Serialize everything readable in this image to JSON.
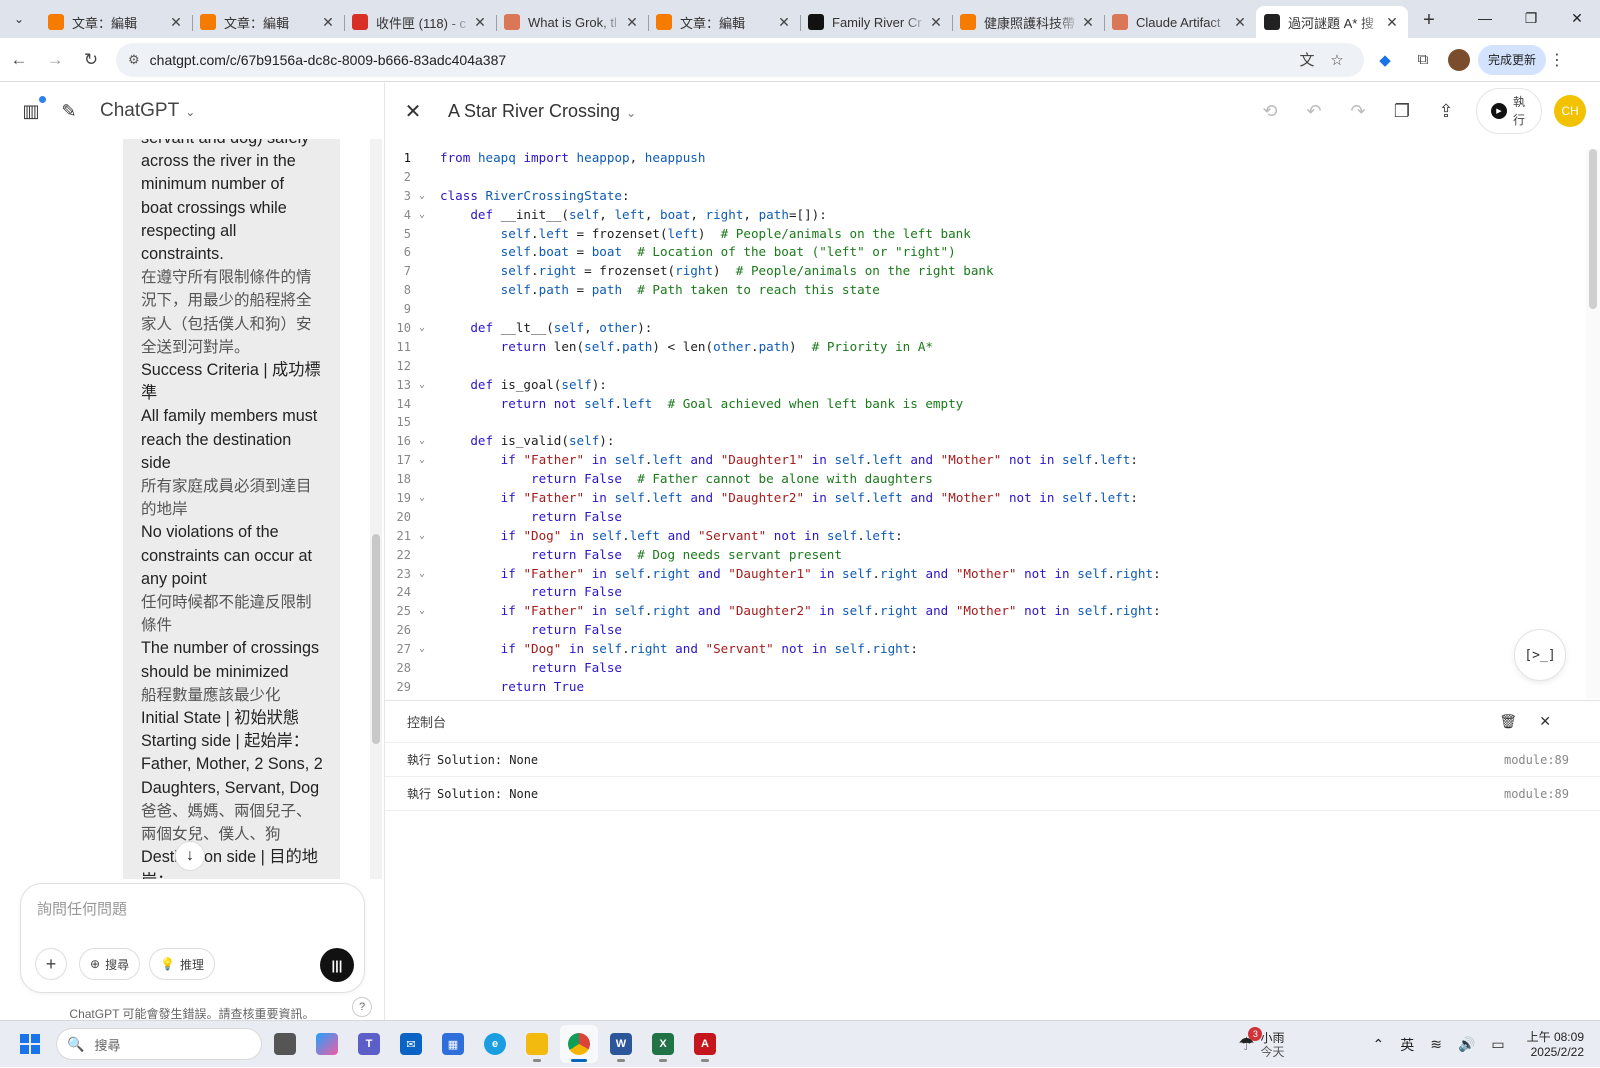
{
  "browser": {
    "tabs": [
      {
        "title": "文章：編輯",
        "favicon": "blogger-icon",
        "color": "#f57c00",
        "active": false
      },
      {
        "title": "文章：編輯",
        "favicon": "blogger-icon",
        "color": "#f57c00",
        "active": false
      },
      {
        "title": "收件匣 (118) - c",
        "favicon": "gmail-icon",
        "color": "#d93025",
        "active": false
      },
      {
        "title": "What is Grok, tl",
        "favicon": "claude-icon",
        "color": "#d97757",
        "active": false
      },
      {
        "title": "文章：編輯",
        "favicon": "blogger-icon",
        "color": "#f57c00",
        "active": false
      },
      {
        "title": "Family River Cr",
        "favicon": "x-icon",
        "color": "#111111",
        "active": false
      },
      {
        "title": "健康照護科技帶",
        "favicon": "blogger-icon",
        "color": "#f57c00",
        "active": false
      },
      {
        "title": "Claude Artifact",
        "favicon": "claude-icon",
        "color": "#d97757",
        "active": false
      },
      {
        "title": "過河謎題 A* 搜",
        "favicon": "chatgpt-icon",
        "color": "#222222",
        "active": true
      }
    ],
    "url": "chatgpt.com/c/67b9156a-dc8c-8009-b666-83adc404a387",
    "update_label": "完成更新"
  },
  "chat": {
    "brand": "ChatGPT",
    "message_lines": [
      {
        "text": "servant and dog) safely",
        "zh": false
      },
      {
        "text": "across the river in the",
        "zh": false
      },
      {
        "text": "minimum number of",
        "zh": false
      },
      {
        "text": "boat crossings while",
        "zh": false
      },
      {
        "text": "respecting all",
        "zh": false
      },
      {
        "text": "constraints.",
        "zh": false
      },
      {
        "text": "在遵守所有限制條件的情",
        "zh": true
      },
      {
        "text": "況下，用最少的船程將全",
        "zh": true
      },
      {
        "text": "家人（包括僕人和狗）安",
        "zh": true
      },
      {
        "text": "全送到河對岸。",
        "zh": true
      },
      {
        "text": "Success Criteria | 成功標",
        "zh": false
      },
      {
        "text": "準",
        "zh": false
      },
      {
        "text": "All family members must",
        "zh": false
      },
      {
        "text": "reach the destination",
        "zh": false
      },
      {
        "text": "side",
        "zh": false
      },
      {
        "text": "所有家庭成員必須到達目",
        "zh": true
      },
      {
        "text": "的地岸",
        "zh": true
      },
      {
        "text": "No violations of the",
        "zh": false
      },
      {
        "text": "constraints can occur at",
        "zh": false
      },
      {
        "text": "any point",
        "zh": false
      },
      {
        "text": "任何時候都不能違反限制",
        "zh": true
      },
      {
        "text": "條件",
        "zh": true
      },
      {
        "text": "The number of crossings",
        "zh": false
      },
      {
        "text": "should be minimized",
        "zh": false
      },
      {
        "text": "船程數量應該最少化",
        "zh": true
      },
      {
        "text": "Initial State | 初始狀態",
        "zh": false
      },
      {
        "text": "Starting side | 起始岸：",
        "zh": false
      },
      {
        "text": "Father, Mother, 2 Sons, 2",
        "zh": false
      },
      {
        "text": "Daughters, Servant, Dog",
        "zh": false
      },
      {
        "text": "爸爸、媽媽、兩個兒子、",
        "zh": true
      },
      {
        "text": "兩個女兒、僕人、狗",
        "zh": true
      },
      {
        "text": "Destination side | 目的地",
        "zh": false
      },
      {
        "text": "岸：",
        "zh": false
      }
    ],
    "composer_placeholder": "詢問任何問題",
    "search_label": "搜尋",
    "reason_label": "推理",
    "disclaimer": "ChatGPT 可能會發生錯誤。請查核重要資訊。",
    "help": "?"
  },
  "canvas": {
    "title": "A Star River Crossing",
    "run_label": "執行",
    "user_initials": "CH",
    "code_lines": [
      "<span class=\"kw\">from</span> <span class=\"bl\">heapq</span> <span class=\"kw\">import</span> <span class=\"bl\">heappop</span>, <span class=\"bl\">heappush</span>",
      "",
      "<span class=\"kw\">class</span> <span class=\"cls\">RiverCrossingState</span>:",
      "    <span class=\"kw\">def</span> <span class=\"fn\">__init__</span>(<span class=\"bl\">self</span>, <span class=\"bl\">left</span>, <span class=\"bl\">boat</span>, <span class=\"bl\">right</span>, <span class=\"bl\">path</span>=[]):",
      "        <span class=\"bl\">self</span>.<span class=\"bl\">left</span> = <span class=\"fn\">frozenset</span>(<span class=\"bl\">left</span>)  <span class=\"cm\"># People/animals on the left bank</span>",
      "        <span class=\"bl\">self</span>.<span class=\"bl\">boat</span> = <span class=\"bl\">boat</span>  <span class=\"cm\"># Location of the boat (\"left\" or \"right\")</span>",
      "        <span class=\"bl\">self</span>.<span class=\"bl\">right</span> = <span class=\"fn\">frozenset</span>(<span class=\"bl\">right</span>)  <span class=\"cm\"># People/animals on the right bank</span>",
      "        <span class=\"bl\">self</span>.<span class=\"bl\">path</span> = <span class=\"bl\">path</span>  <span class=\"cm\"># Path taken to reach this state</span>",
      "",
      "    <span class=\"kw\">def</span> <span class=\"fn\">__lt__</span>(<span class=\"bl\">self</span>, <span class=\"bl\">other</span>):",
      "        <span class=\"kw\">return</span> <span class=\"fn\">len</span>(<span class=\"bl\">self</span>.<span class=\"bl\">path</span>) &lt; <span class=\"fn\">len</span>(<span class=\"bl\">other</span>.<span class=\"bl\">path</span>)  <span class=\"cm\"># Priority in A*</span>",
      "",
      "    <span class=\"kw\">def</span> <span class=\"fn\">is_goal</span>(<span class=\"bl\">self</span>):",
      "        <span class=\"kw\">return</span> <span class=\"kw\">not</span> <span class=\"bl\">self</span>.<span class=\"bl\">left</span>  <span class=\"cm\"># Goal achieved when left bank is empty</span>",
      "",
      "    <span class=\"kw\">def</span> <span class=\"fn\">is_valid</span>(<span class=\"bl\">self</span>):",
      "        <span class=\"kw\">if</span> <span class=\"st\">\"Father\"</span> <span class=\"kw\">in</span> <span class=\"bl\">self</span>.<span class=\"bl\">left</span> <span class=\"kw\">and</span> <span class=\"st\">\"Daughter1\"</span> <span class=\"kw\">in</span> <span class=\"bl\">self</span>.<span class=\"bl\">left</span> <span class=\"kw\">and</span> <span class=\"st\">\"Mother\"</span> <span class=\"kw\">not</span> <span class=\"kw\">in</span> <span class=\"bl\">self</span>.<span class=\"bl\">left</span>:",
      "            <span class=\"kw\">return</span> <span class=\"kw\">False</span>  <span class=\"cm\"># Father cannot be alone with daughters</span>",
      "        <span class=\"kw\">if</span> <span class=\"st\">\"Father\"</span> <span class=\"kw\">in</span> <span class=\"bl\">self</span>.<span class=\"bl\">left</span> <span class=\"kw\">and</span> <span class=\"st\">\"Daughter2\"</span> <span class=\"kw\">in</span> <span class=\"bl\">self</span>.<span class=\"bl\">left</span> <span class=\"kw\">and</span> <span class=\"st\">\"Mother\"</span> <span class=\"kw\">not</span> <span class=\"kw\">in</span> <span class=\"bl\">self</span>.<span class=\"bl\">left</span>:",
      "            <span class=\"kw\">return</span> <span class=\"kw\">False</span>",
      "        <span class=\"kw\">if</span> <span class=\"st\">\"Dog\"</span> <span class=\"kw\">in</span> <span class=\"bl\">self</span>.<span class=\"bl\">left</span> <span class=\"kw\">and</span> <span class=\"st\">\"Servant\"</span> <span class=\"kw\">not</span> <span class=\"kw\">in</span> <span class=\"bl\">self</span>.<span class=\"bl\">left</span>:",
      "            <span class=\"kw\">return</span> <span class=\"kw\">False</span>  <span class=\"cm\"># Dog needs servant present</span>",
      "        <span class=\"kw\">if</span> <span class=\"st\">\"Father\"</span> <span class=\"kw\">in</span> <span class=\"bl\">self</span>.<span class=\"bl\">right</span> <span class=\"kw\">and</span> <span class=\"st\">\"Daughter1\"</span> <span class=\"kw\">in</span> <span class=\"bl\">self</span>.<span class=\"bl\">right</span> <span class=\"kw\">and</span> <span class=\"st\">\"Mother\"</span> <span class=\"kw\">not</span> <span class=\"kw\">in</span> <span class=\"bl\">self</span>.<span class=\"bl\">right</span>:",
      "            <span class=\"kw\">return</span> <span class=\"kw\">False</span>",
      "        <span class=\"kw\">if</span> <span class=\"st\">\"Father\"</span> <span class=\"kw\">in</span> <span class=\"bl\">self</span>.<span class=\"bl\">right</span> <span class=\"kw\">and</span> <span class=\"st\">\"Daughter2\"</span> <span class=\"kw\">in</span> <span class=\"bl\">self</span>.<span class=\"bl\">right</span> <span class=\"kw\">and</span> <span class=\"st\">\"Mother\"</span> <span class=\"kw\">not</span> <span class=\"kw\">in</span> <span class=\"bl\">self</span>.<span class=\"bl\">right</span>:",
      "            <span class=\"kw\">return</span> <span class=\"kw\">False</span>",
      "        <span class=\"kw\">if</span> <span class=\"st\">\"Dog\"</span> <span class=\"kw\">in</span> <span class=\"bl\">self</span>.<span class=\"bl\">right</span> <span class=\"kw\">and</span> <span class=\"st\">\"Servant\"</span> <span class=\"kw\">not</span> <span class=\"kw\">in</span> <span class=\"bl\">self</span>.<span class=\"bl\">right</span>:",
      "            <span class=\"kw\">return</span> <span class=\"kw\">False</span>",
      "        <span class=\"kw\">return</span> <span class=\"kw\">True</span>",
      ""
    ],
    "fold_lines": [
      3,
      4,
      10,
      13,
      16,
      17,
      19,
      21,
      23,
      25,
      27
    ],
    "current_line": 1,
    "console": {
      "title": "控制台",
      "logs": [
        {
          "level": "執行",
          "message": "Solution: None",
          "source": "module:89"
        },
        {
          "level": "執行",
          "message": "Solution: None",
          "source": "module:89"
        }
      ]
    }
  },
  "taskbar": {
    "search_placeholder": "搜尋",
    "weather_text": "小雨",
    "weather_sub": "今天",
    "weather_badge": "3",
    "ime": "英",
    "time": "上午 08:09",
    "date": "2025/2/22"
  }
}
